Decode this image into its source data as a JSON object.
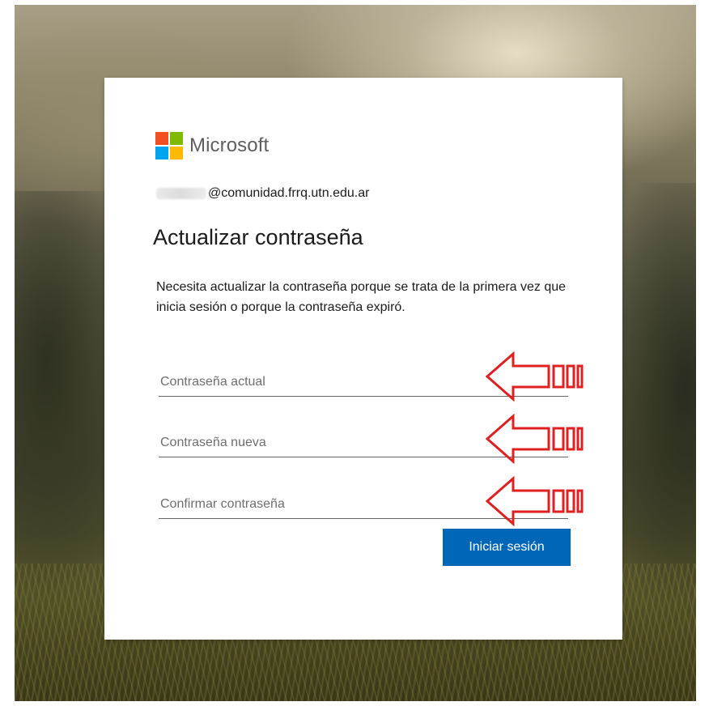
{
  "brand": {
    "name": "Microsoft",
    "colors": {
      "red": "#f25022",
      "green": "#7fba00",
      "blue": "#00a4ef",
      "yellow": "#ffb900"
    }
  },
  "account": {
    "email_domain": "@comunidad.frrq.utn.edu.ar"
  },
  "form": {
    "title": "Actualizar contraseña",
    "description": "Necesita actualizar la contraseña porque se trata de la primera vez que inicia sesión o porque la contraseña expiró.",
    "fields": [
      {
        "placeholder": "Contraseña actual",
        "value": ""
      },
      {
        "placeholder": "Contraseña nueva",
        "value": ""
      },
      {
        "placeholder": "Confirmar contraseña",
        "value": ""
      }
    ],
    "submit_label": "Iniciar sesión",
    "accent_color": "#0067b8"
  },
  "annotations": {
    "arrow_color": "#e02020",
    "arrow_icon": "left-arrow-icon"
  }
}
